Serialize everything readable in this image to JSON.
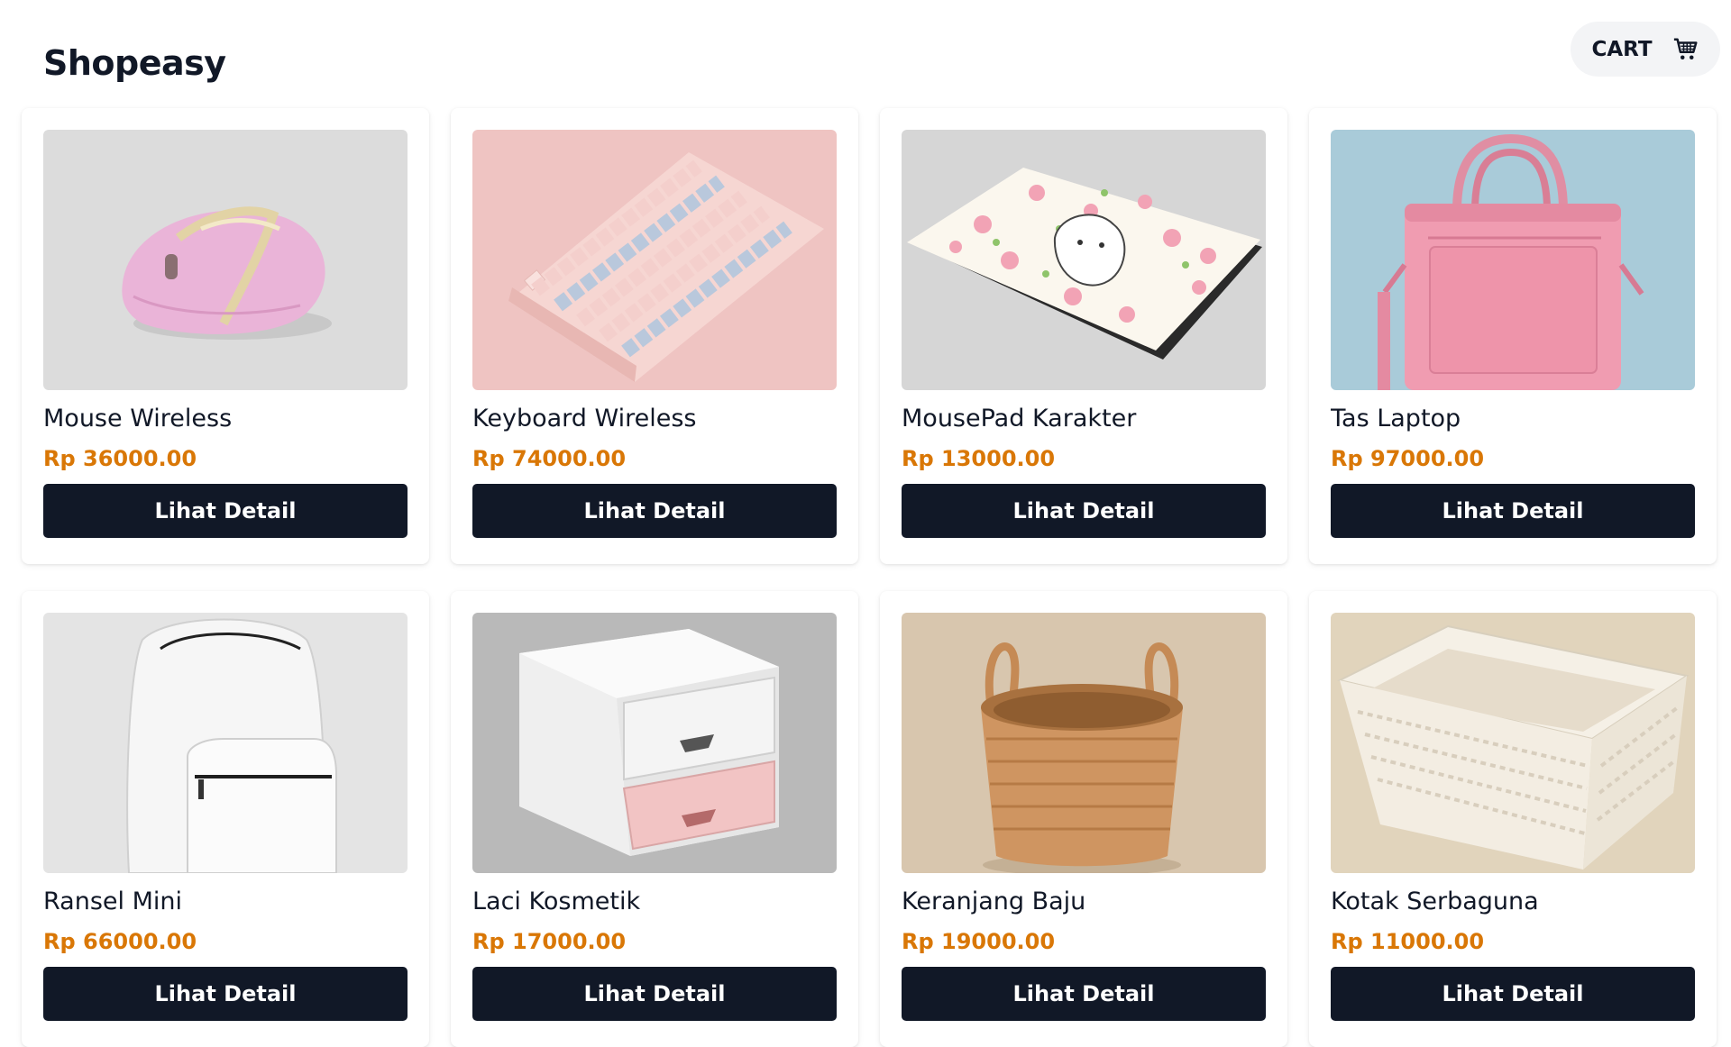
{
  "header": {
    "brand": "Shopeasy",
    "cart_label": "CART",
    "cart_icon": "shopping-cart-icon"
  },
  "products": [
    {
      "name": "Mouse Wireless",
      "price": "Rp 36000.00",
      "button": "Lihat Detail",
      "image": "pink-wireless-mouse"
    },
    {
      "name": "Keyboard Wireless",
      "price": "Rp 74000.00",
      "button": "Lihat Detail",
      "image": "pastel-keyboard"
    },
    {
      "name": "MousePad Karakter",
      "price": "Rp 13000.00",
      "button": "Lihat Detail",
      "image": "character-mousepad"
    },
    {
      "name": "Tas Laptop",
      "price": "Rp 97000.00",
      "button": "Lihat Detail",
      "image": "pink-laptop-bag"
    },
    {
      "name": "Ransel Mini",
      "price": "Rp 66000.00",
      "button": "Lihat Detail",
      "image": "white-mini-backpack"
    },
    {
      "name": "Laci Kosmetik",
      "price": "Rp 17000.00",
      "button": "Lihat Detail",
      "image": "cosmetic-drawer"
    },
    {
      "name": "Keranjang Baju",
      "price": "Rp 19000.00",
      "button": "Lihat Detail",
      "image": "rattan-laundry-basket"
    },
    {
      "name": "Kotak Serbaguna",
      "price": "Rp 11000.00",
      "button": "Lihat Detail",
      "image": "white-storage-basket"
    }
  ],
  "colors": {
    "price": "#d97706",
    "button_bg": "#111827",
    "button_text": "#ffffff",
    "cart_bg": "#f3f4f6"
  }
}
